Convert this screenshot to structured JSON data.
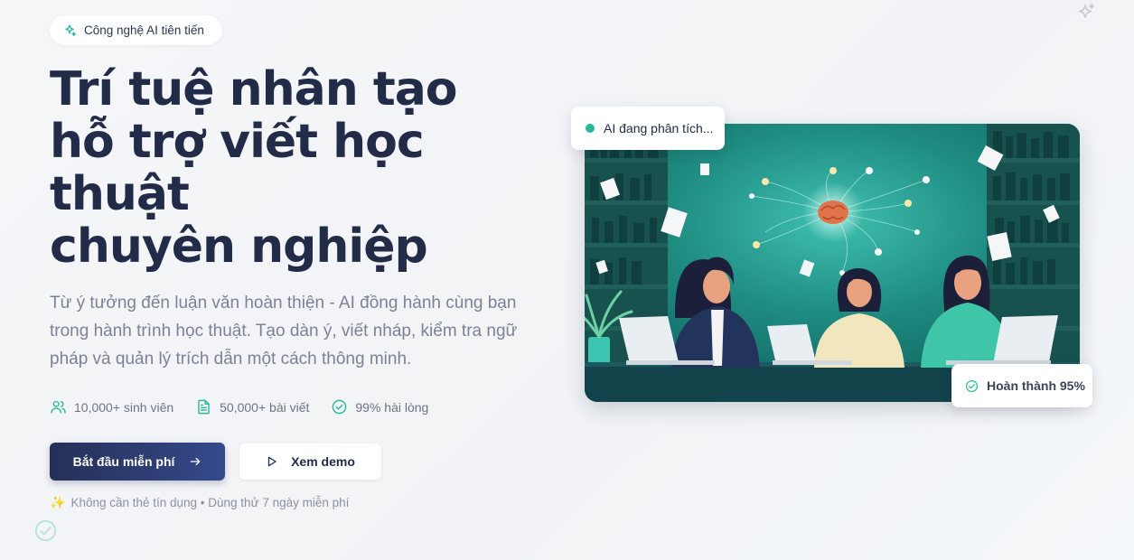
{
  "badge": {
    "icon": "sparkles-icon",
    "label": "Công nghệ AI tiên tiến"
  },
  "hero": {
    "title_lines": [
      "Trí tuệ nhân tạo",
      "hỗ trợ viết học",
      "thuật",
      "chuyên nghiệp"
    ],
    "subtitle": "Từ ý tưởng đến luận văn hoàn thiện - AI đồng hành cùng bạn trong hành trình học thuật. Tạo dàn ý, viết nháp, kiểm tra ngữ pháp và quản lý trích dẫn một cách thông minh."
  },
  "stats": [
    {
      "icon": "users-icon",
      "label": "10,000+ sinh viên"
    },
    {
      "icon": "document-icon",
      "label": "50,000+ bài viết"
    },
    {
      "icon": "check-circle-icon",
      "label": "99% hài lòng"
    }
  ],
  "cta": {
    "primary_label": "Bắt đầu miễn phí",
    "secondary_label": "Xem demo"
  },
  "note": {
    "icon": "sparkles-emoji",
    "text": "Không cần thẻ tín dụng • Dùng thử 7 ngày miễn phí"
  },
  "illustration": {
    "status_card": "AI đang phân tích...",
    "progress_card": "Hoàn thành 95%",
    "progress_value": 95
  },
  "colors": {
    "primary": "#252f58",
    "accent": "#2bb89a",
    "teal_bg": "#1f8c82"
  }
}
